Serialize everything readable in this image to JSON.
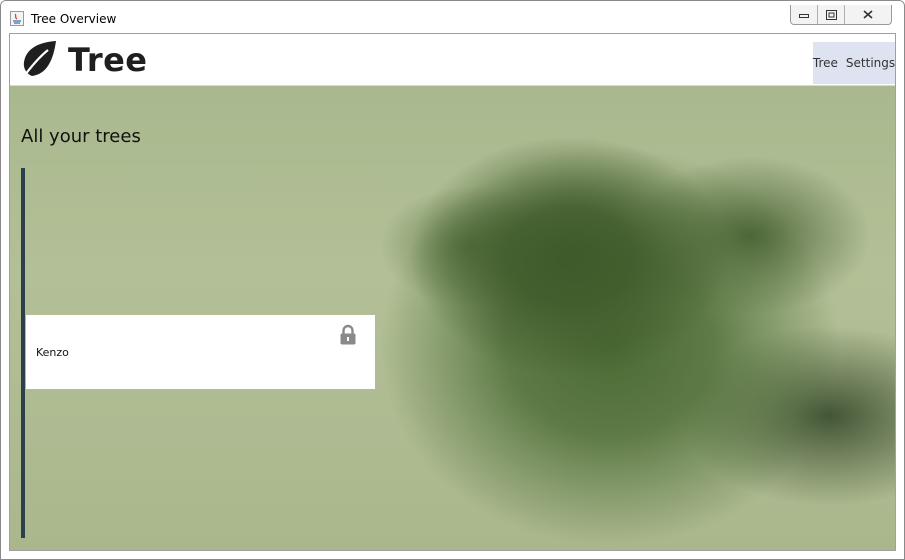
{
  "window": {
    "title": "Tree Overview",
    "controls": {
      "minimize_icon": "minimize-icon",
      "maximize_icon": "restore-icon",
      "close_icon": "close-icon"
    }
  },
  "header": {
    "logo_icon": "leaf-icon",
    "logo_text": "Tree",
    "nav": [
      {
        "label": "Tree"
      },
      {
        "label": "Settings"
      }
    ]
  },
  "main": {
    "heading": "All your trees",
    "trees": [
      {
        "name": "Kenzo",
        "lock_icon": "lock-icon"
      }
    ]
  },
  "colors": {
    "rail": "#2e3f4c",
    "nav_background": "#dde3f0",
    "card_background": "#ffffff"
  }
}
